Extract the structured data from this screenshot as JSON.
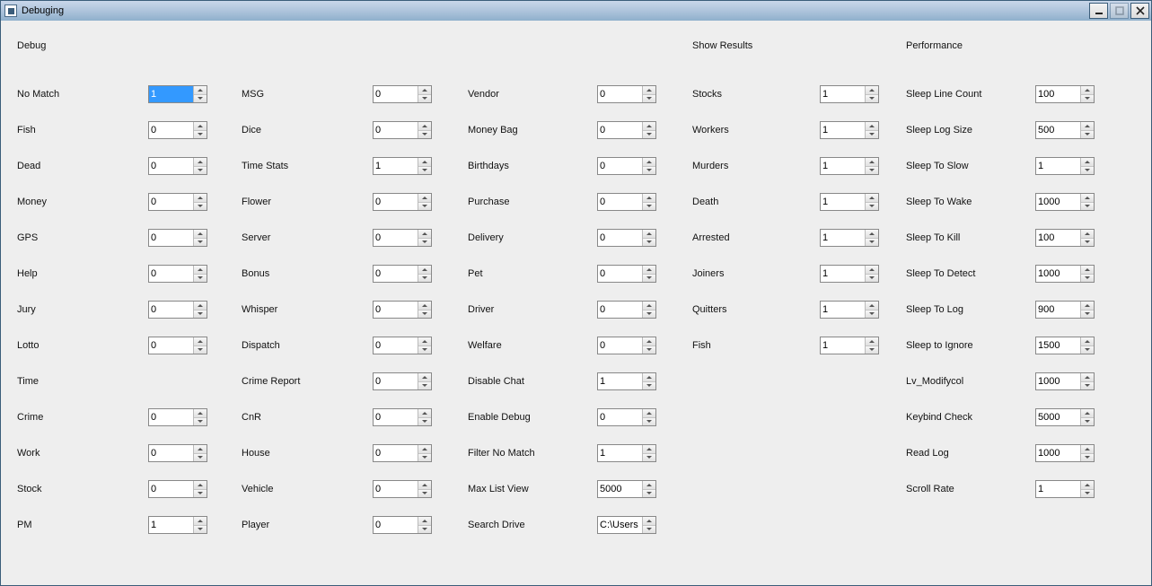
{
  "window": {
    "title": "Debuging"
  },
  "sections": {
    "debug": "Debug",
    "show_results": "Show Results",
    "performance": "Performance"
  },
  "fields": {
    "no_match": {
      "label": "No Match",
      "value": "1"
    },
    "fish": {
      "label": "Fish",
      "value": "0"
    },
    "dead": {
      "label": "Dead",
      "value": "0"
    },
    "money": {
      "label": "Money",
      "value": "0"
    },
    "gps": {
      "label": "GPS",
      "value": "0"
    },
    "help": {
      "label": "Help",
      "value": "0"
    },
    "jury": {
      "label": "Jury",
      "value": "0"
    },
    "lotto": {
      "label": "Lotto",
      "value": "0"
    },
    "time": {
      "label": "Time",
      "value": null
    },
    "crime": {
      "label": "Crime",
      "value": "0"
    },
    "work": {
      "label": "Work",
      "value": "0"
    },
    "stock": {
      "label": "Stock",
      "value": "0"
    },
    "pm": {
      "label": "PM",
      "value": "1"
    },
    "msg": {
      "label": "MSG",
      "value": "0"
    },
    "dice": {
      "label": "Dice",
      "value": "0"
    },
    "time_stats": {
      "label": "Time Stats",
      "value": "1"
    },
    "flower": {
      "label": "Flower",
      "value": "0"
    },
    "server": {
      "label": "Server",
      "value": "0"
    },
    "bonus": {
      "label": "Bonus",
      "value": "0"
    },
    "whisper": {
      "label": "Whisper",
      "value": "0"
    },
    "dispatch": {
      "label": "Dispatch",
      "value": "0"
    },
    "crime_report": {
      "label": "Crime Report",
      "value": "0"
    },
    "cnr": {
      "label": "CnR",
      "value": "0"
    },
    "house": {
      "label": "House",
      "value": "0"
    },
    "vehicle": {
      "label": "Vehicle",
      "value": "0"
    },
    "player": {
      "label": "Player",
      "value": "0"
    },
    "vendor": {
      "label": "Vendor",
      "value": "0"
    },
    "money_bag": {
      "label": "Money Bag",
      "value": "0"
    },
    "birthdays": {
      "label": "Birthdays",
      "value": "0"
    },
    "purchase": {
      "label": "Purchase",
      "value": "0"
    },
    "delivery": {
      "label": "Delivery",
      "value": "0"
    },
    "pet": {
      "label": "Pet",
      "value": "0"
    },
    "driver": {
      "label": "Driver",
      "value": "0"
    },
    "welfare": {
      "label": "Welfare",
      "value": "0"
    },
    "disable_chat": {
      "label": "Disable Chat",
      "value": "1"
    },
    "enable_debug": {
      "label": "Enable Debug",
      "value": "0"
    },
    "filter_no_match": {
      "label": "Filter No Match",
      "value": "1"
    },
    "max_list_view": {
      "label": "Max List View",
      "value": "5000"
    },
    "search_drive": {
      "label": "Search Drive",
      "value": "C:\\Users"
    },
    "stocks": {
      "label": "Stocks",
      "value": "1"
    },
    "workers": {
      "label": "Workers",
      "value": "1"
    },
    "murders": {
      "label": "Murders",
      "value": "1"
    },
    "death": {
      "label": "Death",
      "value": "1"
    },
    "arrested": {
      "label": "Arrested",
      "value": "1"
    },
    "joiners": {
      "label": "Joiners",
      "value": "1"
    },
    "quitters": {
      "label": "Quitters",
      "value": "1"
    },
    "sr_fish": {
      "label": "Fish",
      "value": "1"
    },
    "sleep_line_count": {
      "label": "Sleep Line Count",
      "value": "100"
    },
    "sleep_log_size": {
      "label": "Sleep Log Size",
      "value": "500"
    },
    "sleep_to_slow": {
      "label": "Sleep To Slow",
      "value": "1"
    },
    "sleep_to_wake": {
      "label": "Sleep To Wake",
      "value": "1000"
    },
    "sleep_to_kill": {
      "label": "Sleep To Kill",
      "value": "100"
    },
    "sleep_to_detect": {
      "label": "Sleep To Detect",
      "value": "1000"
    },
    "sleep_to_log": {
      "label": "Sleep To Log",
      "value": "900"
    },
    "sleep_to_ignore": {
      "label": "Sleep to Ignore",
      "value": "1500"
    },
    "lv_modifycol": {
      "label": "Lv_Modifycol",
      "value": "1000"
    },
    "keybind_check": {
      "label": "Keybind Check",
      "value": "5000"
    },
    "read_log": {
      "label": "Read Log",
      "value": "1000"
    },
    "scroll_rate": {
      "label": "Scroll Rate",
      "value": "1"
    }
  }
}
